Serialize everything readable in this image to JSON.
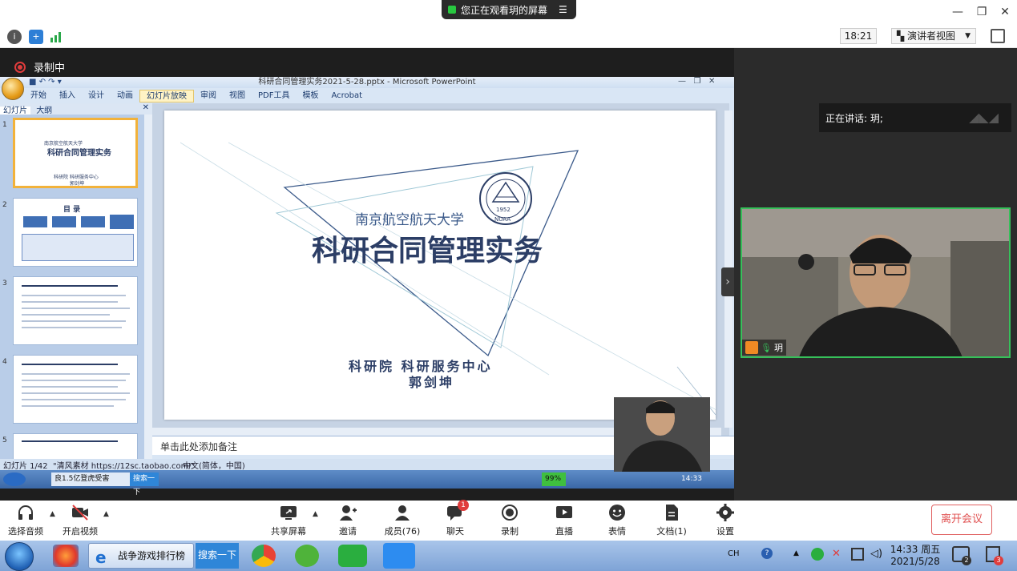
{
  "zoom_top": {
    "share_banner": "您正在观看玥的屏幕",
    "time": "18:21",
    "view_mode": "演讲者视图",
    "recording_label": "录制中",
    "speaking_label": "正在讲话: 玥;"
  },
  "powerpoint": {
    "window_title": "科研合同管理实务2021-5-28.pptx - Microsoft PowerPoint",
    "menu": [
      "开始",
      "插入",
      "设计",
      "动画",
      "幻灯片放映",
      "审阅",
      "视图",
      "PDF工具",
      "模板",
      "Acrobat"
    ],
    "active_menu": "幻灯片放映",
    "side_tabs": [
      "幻灯片",
      "大纲"
    ],
    "thumb_numbers": [
      "1",
      "2",
      "3",
      "4",
      "5"
    ],
    "thumb1": {
      "uni": "南京航空航天大学",
      "title": "科研合同管理实务",
      "sub": "科研院  科研服务中心",
      "name": "郭剑坤"
    },
    "thumb2_title": "目  录",
    "slide": {
      "university": "南京航空航天大学",
      "title": "科研合同管理实务",
      "department": "科研院  科研服务中心",
      "presenter": "郭剑坤",
      "seal_year": "1952",
      "seal_text": "NUAA"
    },
    "notes_placeholder": "单击此处添加备注",
    "status": {
      "slide_count": "幻灯片 1/42",
      "theme": "\"清风素材 https://12sc.taobao.com/\"",
      "language": "中文(简体，中国)"
    },
    "inner_taskbar": {
      "ie_tab": "良1.5亿登虎受害",
      "search": "搜索一下",
      "battery": "99%",
      "time": "14:33"
    }
  },
  "video": {
    "participant_name": "玥"
  },
  "zoom_bottom": {
    "buttons": [
      {
        "label": "选择音频",
        "icon": "headphone-icon"
      },
      {
        "label": "开启视频",
        "icon": "camera-off-icon"
      },
      {
        "label": "共享屏幕",
        "icon": "share-screen-icon"
      },
      {
        "label": "邀请",
        "icon": "invite-icon"
      },
      {
        "label": "成员(76)",
        "icon": "members-icon"
      },
      {
        "label": "聊天",
        "icon": "chat-icon",
        "badge": "1"
      },
      {
        "label": "录制",
        "icon": "record-icon"
      },
      {
        "label": "直播",
        "icon": "live-icon"
      },
      {
        "label": "表情",
        "icon": "emoji-icon"
      },
      {
        "label": "文档(1)",
        "icon": "document-icon"
      },
      {
        "label": "设置",
        "icon": "settings-icon"
      }
    ],
    "leave": "离开会议"
  },
  "windows_taskbar": {
    "ie_label": "战争游戏排行榜",
    "search": "搜索一下",
    "ime": "CH",
    "time": "14:33 周五",
    "date": "2021/5/28",
    "notif_badge1": "2",
    "notif_badge2": "3"
  },
  "colors": {
    "accent_green": "#36c05a",
    "leave_red": "#e05050",
    "slide_title": "#2c3e66"
  }
}
